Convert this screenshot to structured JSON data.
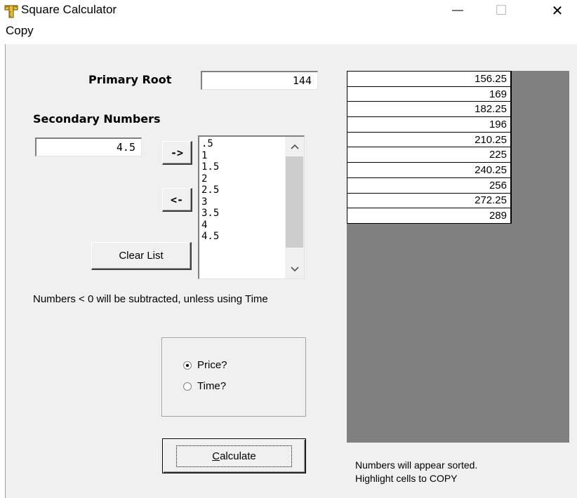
{
  "window": {
    "title": "Square Calculator",
    "minimize_glyph": "—",
    "maximize_glyph": "☐",
    "close_glyph": "✕"
  },
  "menu": {
    "copy_label": "Copy"
  },
  "primary": {
    "label": "Primary Root",
    "value": "144"
  },
  "secondary": {
    "label": "Secondary Numbers",
    "input_value": "4.5",
    "add_label": "->",
    "remove_label": "<-",
    "clear_label": "Clear List",
    "list": [
      ".5",
      "1",
      "1.5",
      "2",
      "2.5",
      "3",
      "3.5",
      "4",
      "4.5"
    ]
  },
  "note": "Numbers <  0 will be subtracted, unless using Time",
  "mode": {
    "options": [
      {
        "label": "Price?",
        "selected": true
      },
      {
        "label": "Time?",
        "selected": false
      }
    ]
  },
  "calculate": {
    "label_prefix": "",
    "label_mnemonic": "C",
    "label_rest": "alculate"
  },
  "results": {
    "values": [
      "156.25",
      "169",
      "182.25",
      "196",
      "210.25",
      "225",
      "240.25",
      "256",
      "272.25",
      "289"
    ],
    "hint_line1": "Numbers will appear sorted.",
    "hint_line2": "Highlight cells to COPY"
  },
  "colors": {
    "grid_background": "#808080",
    "dialog_face": "#f0f0f0"
  },
  "icons": {
    "app": "ruler-calculator-icon"
  }
}
